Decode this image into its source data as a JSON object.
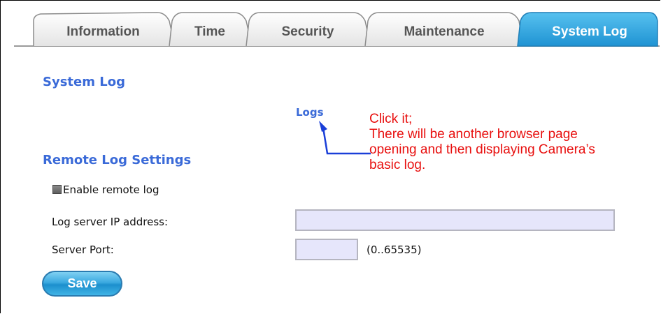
{
  "tabs": [
    {
      "label": "Information",
      "active": false
    },
    {
      "label": "Time",
      "active": false
    },
    {
      "label": "Security",
      "active": false
    },
    {
      "label": "Maintenance",
      "active": false
    },
    {
      "label": "System Log",
      "active": true
    }
  ],
  "system_log": {
    "title": "System Log",
    "logs_link": "Logs"
  },
  "annotation": {
    "lines": [
      "Click it;",
      "There will be another browser page",
      "opening and then displaying Camera’s",
      "basic log."
    ],
    "color": "#e8100f",
    "arrow_color": "#1a3fd8"
  },
  "remote_log": {
    "title": "Remote Log Settings",
    "enable_label": "Enable remote log",
    "ip_label": "Log server IP address:",
    "ip_value": "",
    "port_label": "Server Port:",
    "port_value": "",
    "port_range": "(0..65535)",
    "save_label": "Save"
  },
  "colors": {
    "accent": "#3a6ad8",
    "active_tab": "#2fa3dc",
    "input_bg": "#e6e6fb"
  }
}
